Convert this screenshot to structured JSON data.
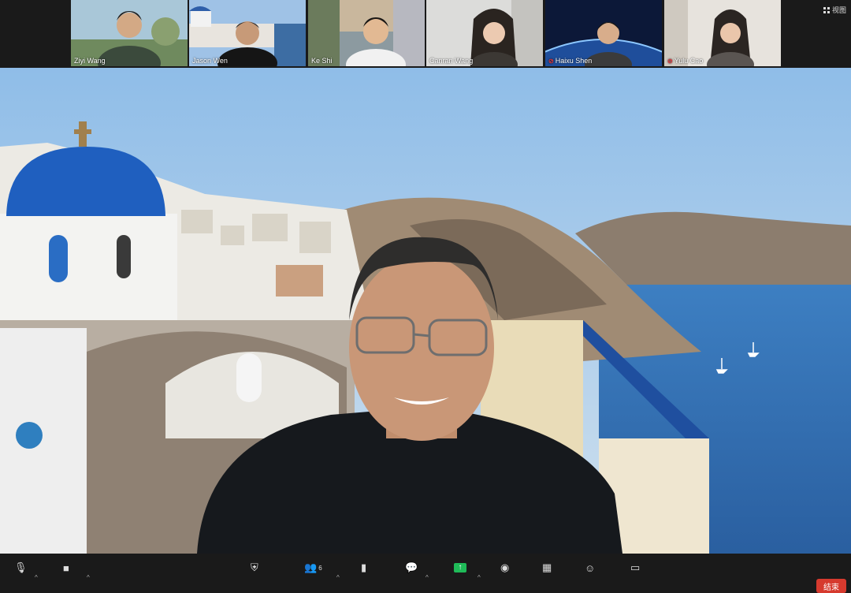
{
  "participants": [
    {
      "name": "Ziyi Wang",
      "muted": false
    },
    {
      "name": "Jason Wen",
      "muted": false
    },
    {
      "name": "Ke Shi",
      "muted": false
    },
    {
      "name": "Canran Wang",
      "muted": false
    },
    {
      "name": "Haixu Shen",
      "muted": true
    },
    {
      "name": "Yulu Cao",
      "muted": true
    }
  ],
  "view_button": {
    "label": "视图"
  },
  "toolbar": {
    "participants_count": "6",
    "end_label": "结束"
  },
  "colors": {
    "end": "#d63a2e",
    "share": "#1fbb58",
    "mute": "#e0383e"
  }
}
